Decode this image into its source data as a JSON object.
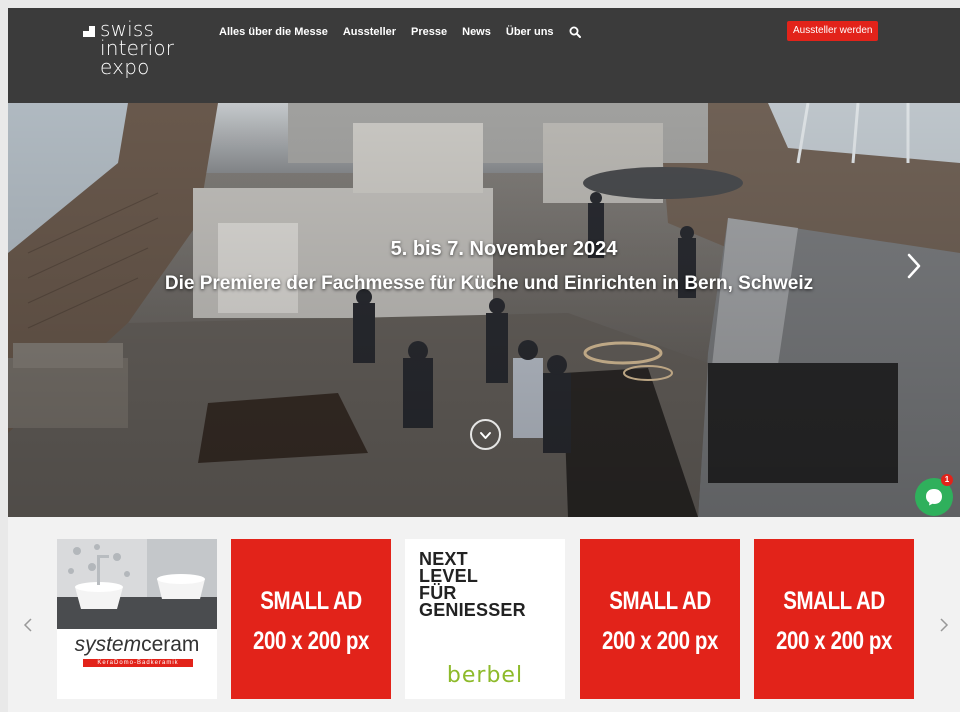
{
  "header": {
    "logo": {
      "line1": "swiss",
      "line2": "interior",
      "line3": "expo"
    },
    "nav": [
      {
        "label": "Alles über die Messe"
      },
      {
        "label": "Aussteller"
      },
      {
        "label": "Presse"
      },
      {
        "label": "News"
      },
      {
        "label": "Über uns"
      }
    ],
    "search_icon": "search-icon",
    "cta_label": "Aussteller werden"
  },
  "hero": {
    "date": "5. bis 7. November 2024",
    "subtitle": "Die Premiere der Fachmesse für Küche und Einrichten in Bern, Schweiz",
    "next_icon": "chevron-right-icon",
    "scroll_icon": "chevron-down-circle-icon"
  },
  "chat": {
    "icon": "chat-bubble-icon",
    "badge": "1"
  },
  "ads": {
    "prev_icon": "chevron-left-icon",
    "next_icon": "chevron-right-icon",
    "items": [
      {
        "type": "systemceram",
        "brand_prefix": "system",
        "brand_suffix": "ceram",
        "tag": "KeraDomo-Badkeramik"
      },
      {
        "type": "small",
        "line1": "SMALL AD",
        "line2": "200 x 200 px"
      },
      {
        "type": "berbel",
        "slogan": [
          "NEXT",
          "LEVEL",
          "FÜR",
          "GENIESSER"
        ],
        "brand": "berbel"
      },
      {
        "type": "small",
        "line1": "SMALL AD",
        "line2": "200 x 200 px"
      },
      {
        "type": "small",
        "line1": "SMALL AD",
        "line2": "200 x 200 px"
      }
    ]
  },
  "colors": {
    "header_bg": "#3b3b3b",
    "accent_red": "#e2231a",
    "chat_green": "#2fb05c",
    "berbel_green": "#8dba2a",
    "page_bg": "#f2f2f2"
  }
}
